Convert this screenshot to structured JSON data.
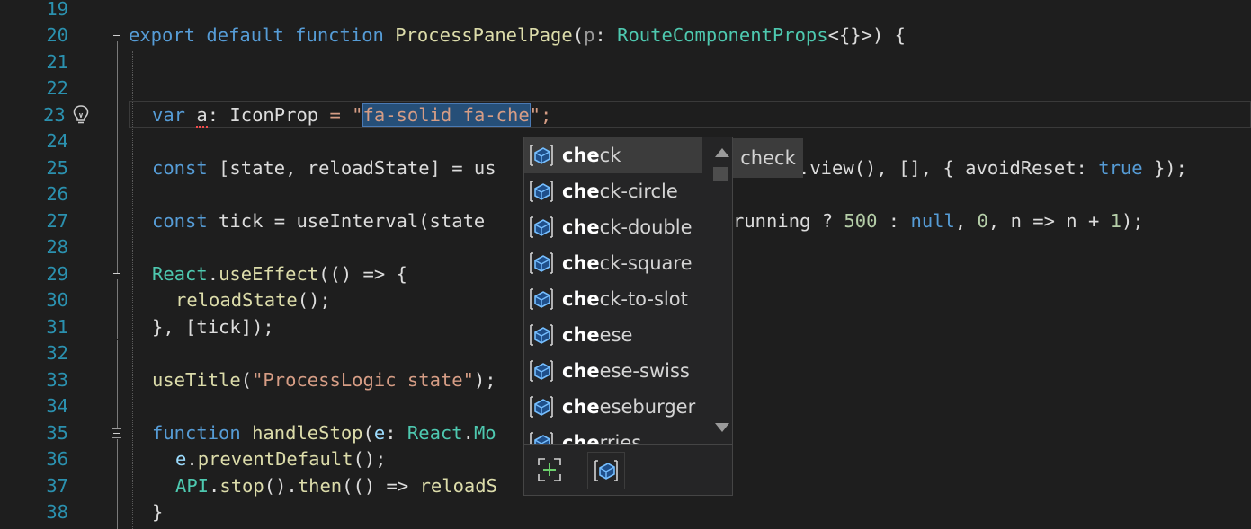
{
  "editor": {
    "line_numbers": [
      "19",
      "20",
      "21",
      "22",
      "23",
      "24",
      "25",
      "26",
      "27",
      "28",
      "29",
      "30",
      "31",
      "32",
      "33",
      "34",
      "35",
      "36",
      "37",
      "38"
    ],
    "lines": {
      "l20": {
        "kw1": "export",
        "kw2": "default",
        "kw3": "function",
        "fname": "ProcessPanelPage",
        "p1": "(",
        "param": "p",
        "p2": ": ",
        "type": "RouteComponentProps",
        "p3": "<{}>) {"
      },
      "l23": {
        "kw": "var",
        "space": " ",
        "var": "a",
        "p1": ": ",
        "type": "IconProp",
        "p2": " = \"",
        "str_sel": "fa-solid fa-che",
        "p3": "\";"
      },
      "l25": {
        "kw": "const",
        "text": " [state, reloadState] = us",
        "text2": ".view(), [], { avoidReset: ",
        "bool": "true",
        "text3": " });"
      },
      "l27": {
        "kw": "const",
        "text": " tick = useInterval(state",
        "text2": "running ? ",
        "num1": "500",
        "text3": " : ",
        "kw2": "null",
        "text4": ", ",
        "num2": "0",
        "text5": ", n => n + ",
        "num3": "1",
        "text6": ");"
      },
      "l29": {
        "ty": "React",
        "dot": ".",
        "fn": "useEffect",
        "text": "(() => {"
      },
      "l30": {
        "fn": "reloadState",
        "text": "();"
      },
      "l31": {
        "text": "}, [tick]);"
      },
      "l33": {
        "fn": "useTitle",
        "p1": "(",
        "str": "\"ProcessLogic state\"",
        "p2": ");"
      },
      "l35": {
        "kw": "function",
        "sp": " ",
        "fn": "handleStop",
        "p1": "(",
        "param": "e",
        "p2": ": ",
        "ty": "React",
        "dot": ".",
        "ty2": "Mo"
      },
      "l36": {
        "id": "e",
        "dot": ".",
        "fn": "preventDefault",
        "text": "();"
      },
      "l37": {
        "ty": "API",
        "dot": ".",
        "fn": "stop",
        "text": "().",
        "fn2": "then",
        "text2": "(() => ",
        "fn3": "reloadS"
      },
      "l38": {
        "text": "}"
      }
    }
  },
  "completion": {
    "items": [
      {
        "match": "che",
        "rest": "ck"
      },
      {
        "match": "che",
        "rest": "ck-circle"
      },
      {
        "match": "che",
        "rest": "ck-double"
      },
      {
        "match": "che",
        "rest": "ck-square"
      },
      {
        "match": "che",
        "rest": "ck-to-slot"
      },
      {
        "match": "che",
        "rest": "ese"
      },
      {
        "match": "che",
        "rest": "ese-swiss"
      },
      {
        "match": "che",
        "rest": "eseburger"
      },
      {
        "match": "che",
        "rest": "rries"
      }
    ],
    "selected_index": 0,
    "tooltip": "check",
    "icons": {
      "item": "value-cube-icon",
      "footer_expand": "expand-icon",
      "footer_filter": "value-cube-filter-icon"
    },
    "accent_color": "#75beff"
  }
}
